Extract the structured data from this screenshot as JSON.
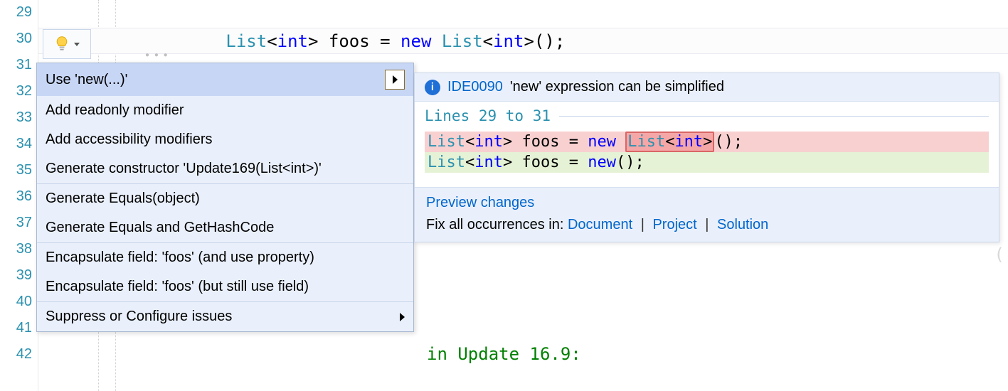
{
  "gutter": {
    "lines": [
      "29",
      "30",
      "31",
      "32",
      "33",
      "34",
      "35",
      "36",
      "37",
      "38",
      "39",
      "40",
      "41",
      "42"
    ]
  },
  "editor": {
    "code_line_30": {
      "indent": "            ",
      "type1": "List",
      "lt1": "<",
      "int1": "int",
      "gt1": ">",
      "mid": " foos = ",
      "new": "new",
      "sp": " ",
      "type2": "List",
      "lt2": "<",
      "int2": "int",
      "gt2": ">",
      "tail": "();"
    },
    "context_tail_text": "in Update 16.9:"
  },
  "menu": {
    "items": [
      {
        "label": "Use 'new(...)'",
        "selected": true,
        "submenu": true
      },
      {
        "label": "Add readonly modifier"
      },
      {
        "label": "Add accessibility modifiers"
      },
      {
        "label": "Generate constructor 'Update169(List<int>)'"
      },
      {
        "sep": true
      },
      {
        "label": "Generate Equals(object)"
      },
      {
        "label": "Generate Equals and GetHashCode"
      },
      {
        "sep": true
      },
      {
        "label": "Encapsulate field: 'foos' (and use property)"
      },
      {
        "label": "Encapsulate field: 'foos' (but still use field)"
      },
      {
        "sep": true
      },
      {
        "label": "Suppress or Configure issues",
        "submenu_simple": true
      }
    ]
  },
  "preview": {
    "diag_id": "IDE0090",
    "diag_msg": "'new' expression can be simplified",
    "lines_label": "Lines 29 to 31",
    "diff": {
      "before": {
        "pre": "List<int> foos = new ",
        "removed": "List<int>",
        "post": "();",
        "type1": "List",
        "int1": "int",
        "new": "new",
        "type2": "List",
        "int2": "int"
      },
      "after": {
        "full": "List<int> foos = new();",
        "type1": "List",
        "int1": "int",
        "new": "new"
      }
    },
    "footer": {
      "preview_link": "Preview changes",
      "fix_label": "Fix all occurrences in:",
      "doc": "Document",
      "proj": "Project",
      "sol": "Solution"
    }
  },
  "chart_data": {
    "type": "table",
    "description": "Quick-actions menu contents",
    "rows": [
      "Use 'new(...)'",
      "Add readonly modifier",
      "Add accessibility modifiers",
      "Generate constructor 'Update169(List<int>)'",
      "Generate Equals(object)",
      "Generate Equals and GetHashCode",
      "Encapsulate field: 'foos' (and use property)",
      "Encapsulate field: 'foos' (but still use field)",
      "Suppress or Configure issues"
    ]
  }
}
